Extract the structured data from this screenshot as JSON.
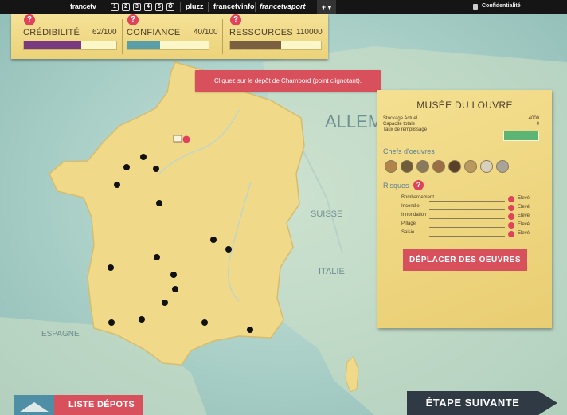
{
  "topbar": {
    "logo": "francetv",
    "channels": [
      "1",
      "2",
      "3",
      "4",
      "5",
      "Ô"
    ],
    "links": [
      "pluzz",
      "francetvinfo",
      "francetvsport"
    ],
    "plus": "+ ▾",
    "privacy": "Confidentialité"
  },
  "stats": [
    {
      "label": "CRÉDIBILITÉ",
      "value": "62/100",
      "fraction": 0.62,
      "color": "#7a3a80"
    },
    {
      "label": "CONFIANCE",
      "value": "40/100",
      "fraction": 0.4,
      "color": "#5a9ea8"
    },
    {
      "label": "RESSOURCES",
      "value": "110000",
      "fraction": 0.56,
      "color": "#7a6040"
    }
  ],
  "tooltip": "Cliquez sur le dépôt de Chambord (point clignotant).",
  "map_labels": {
    "allemagne": "ALLEMAG",
    "suisse": "SUISSE",
    "italie": "ITALIE",
    "espagne": "ESPAGNE"
  },
  "museum": {
    "title": "MUSÉE DU LOUVRE",
    "stock_label": "Stockage Actuel",
    "stock_value": "4000",
    "capacity_label": "Capacité totale",
    "capacity_value": "0",
    "rate_label": "Taux de remplissage",
    "masterpieces_label": "Chefs d'oeuvres",
    "masterpiece_count": 8,
    "risks_label": "Risques",
    "risks": [
      {
        "name": "Bombardement",
        "level": "Elevé"
      },
      {
        "name": "Incendie",
        "level": "Elevé"
      },
      {
        "name": "Innondation",
        "level": "Elevé"
      },
      {
        "name": "Pillage",
        "level": "Elevé"
      },
      {
        "name": "Saisie",
        "level": "Elevé"
      }
    ],
    "move_button": "DÉPLACER DES OEUVRES"
  },
  "buttons": {
    "list": "LISTE DÉPOTS",
    "next": "ÉTAPE SUIVANTE"
  },
  "colors": {
    "land": "#f1d98a",
    "alert": "#d9505d",
    "depot": "#111111"
  }
}
